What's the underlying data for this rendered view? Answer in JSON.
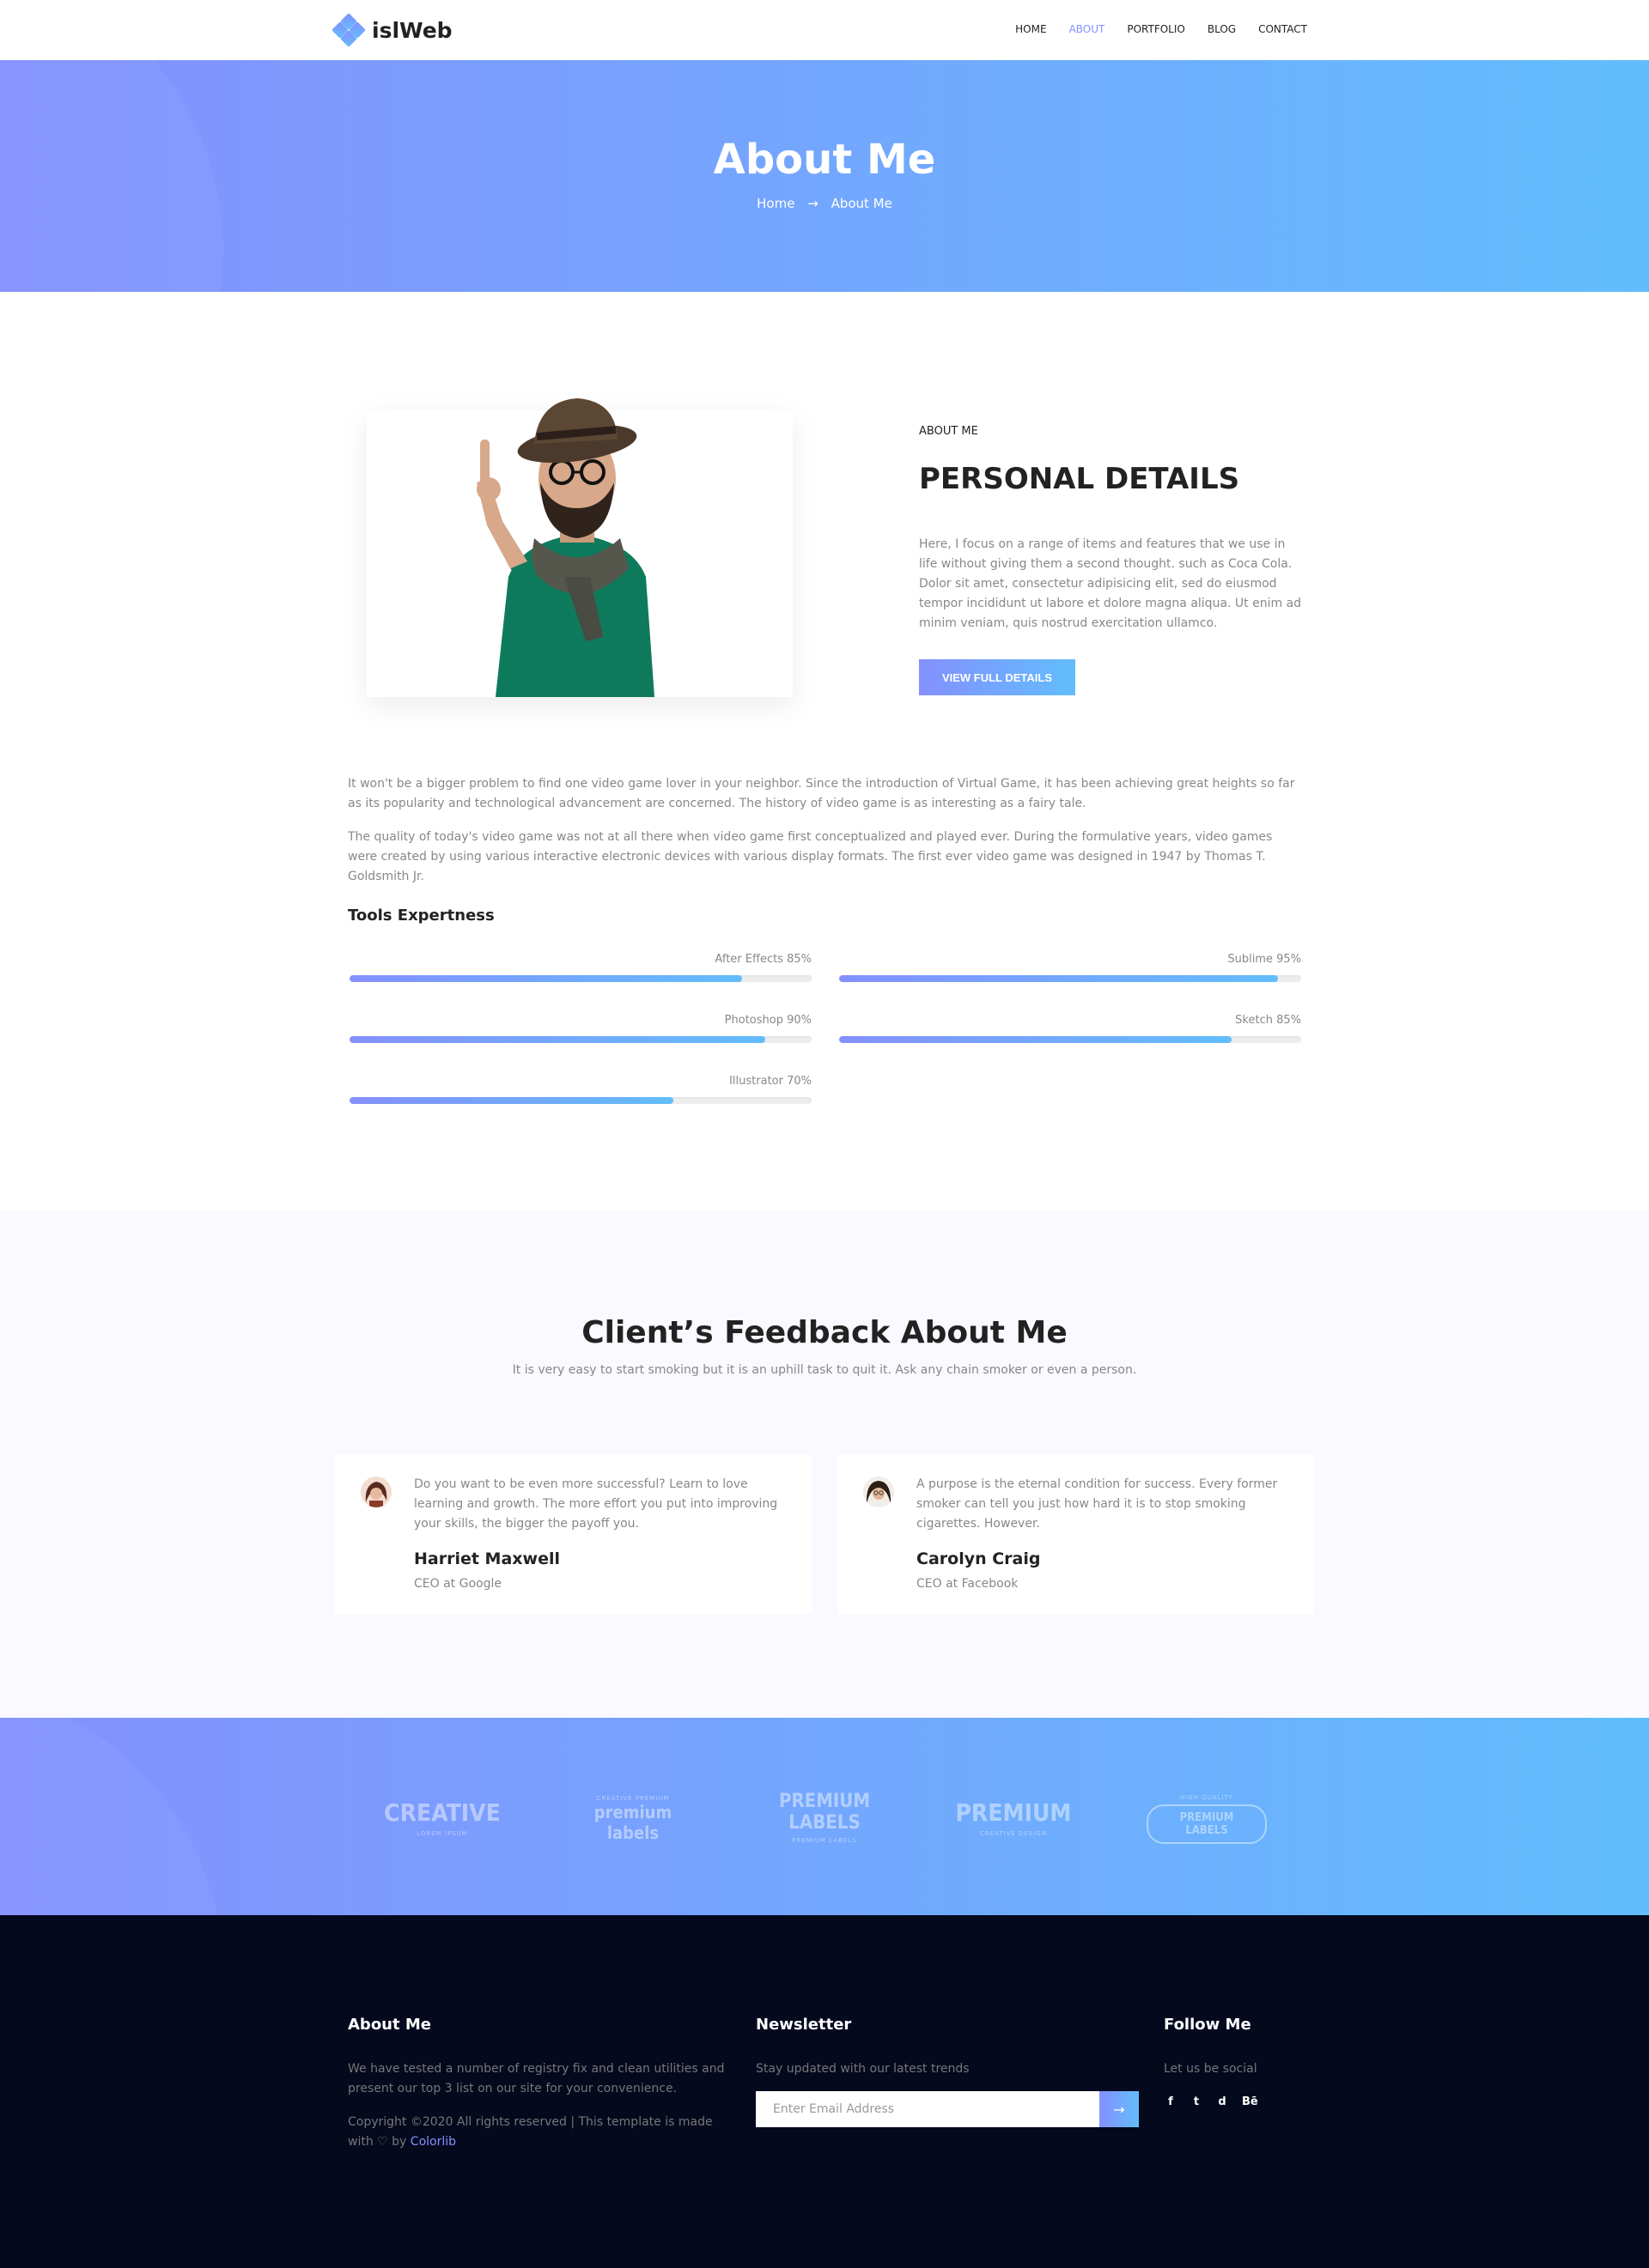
{
  "header": {
    "logo_text": "islWeb",
    "nav": [
      {
        "label": "HOME"
      },
      {
        "label": "ABOUT"
      },
      {
        "label": "PORTFOLIO"
      },
      {
        "label": "BLOG"
      },
      {
        "label": "CONTACT"
      }
    ]
  },
  "hero": {
    "title": "About Me",
    "breadcrumb_home": "Home",
    "breadcrumb_current": "About Me"
  },
  "about": {
    "label": "ABOUT ME",
    "heading": "PERSONAL DETAILS",
    "paragraph": "Here, I focus on a range of items and features that we use in life without giving them a second thought. such as Coca Cola. Dolor sit amet, consectetur adipisicing elit, sed do eiusmod tempor incididunt ut labore et dolore magna aliqua. Ut enim ad minim veniam, quis nostrud exercitation ullamco.",
    "button": "VIEW FULL DETAILS",
    "paragraph_2": "It won't be a bigger problem to find one video game lover in your neighbor. Since the introduction of Virtual Game, it has been achieving great heights so far as its popularity and technological advancement are concerned. The history of video game is as interesting as a fairy tale.",
    "paragraph_3": "The quality of today's video game was not at all there when video game first conceptualized and played ever. During the formulative years, video games were created by using various interactive electronic devices with various display formats. The first ever video game was designed in 1947 by Thomas T. Goldsmith Jr."
  },
  "tools": {
    "title": "Tools Expertness",
    "skills": [
      {
        "label": "After Effects 85%",
        "percent": 85
      },
      {
        "label": "Sublime 95%",
        "percent": 95
      },
      {
        "label": "Photoshop 90%",
        "percent": 90
      },
      {
        "label": "Sketch 85%",
        "percent": 85
      },
      {
        "label": "Illustrator 70%",
        "percent": 70
      }
    ]
  },
  "feedback": {
    "title": "Client’s Feedback About Me",
    "subtitle": "It is very easy to start smoking but it is an uphill task to quit it. Ask any chain smoker or even a person.",
    "cards": [
      {
        "quote": "Do you want to be even more successful? Learn to love learning and growth. The more effort you put into improving your skills, the bigger the payoff you.",
        "name": "Harriet Maxwell",
        "role": "CEO at Google"
      },
      {
        "quote": "A purpose is the eternal condition for success. Every former smoker can tell you just how hard it is to stop smoking cigarettes. However.",
        "name": "Carolyn Craig",
        "role": "CEO at Facebook"
      }
    ]
  },
  "brands": [
    {
      "big": "CREATIVE",
      "small": "LOREM IPSUM"
    },
    {
      "big": "premium labels",
      "small": "CREATIVE PREMIUM"
    },
    {
      "big": "PREMIUM LABELS",
      "small": "PREMIUM LABELS"
    },
    {
      "big": "PREMIUM",
      "small": "CREATIVE DESIGN"
    },
    {
      "big": "PREMIUM LABELS",
      "small": "HIGH QUALITY"
    }
  ],
  "footer": {
    "about_title": "About Me",
    "about_text": "We have tested a number of registry fix and clean utilities and present our top 3 list on our site for your convenience.",
    "copyright_prefix": "Copyright ©2020 All rights reserved | This template is made with",
    "copyright_by": "by",
    "copyright_link": "Colorlib",
    "newsletter_title": "Newsletter",
    "newsletter_text": "Stay updated with our latest trends",
    "newsletter_placeholder": "Enter Email Address",
    "follow_title": "Follow Me",
    "follow_text": "Let us be social",
    "socials": [
      "f",
      "t",
      "d",
      "Bē"
    ]
  },
  "colors": {
    "accent_start": "#8490ff",
    "accent_end": "#62bdfc",
    "footer_bg": "#04091e"
  }
}
